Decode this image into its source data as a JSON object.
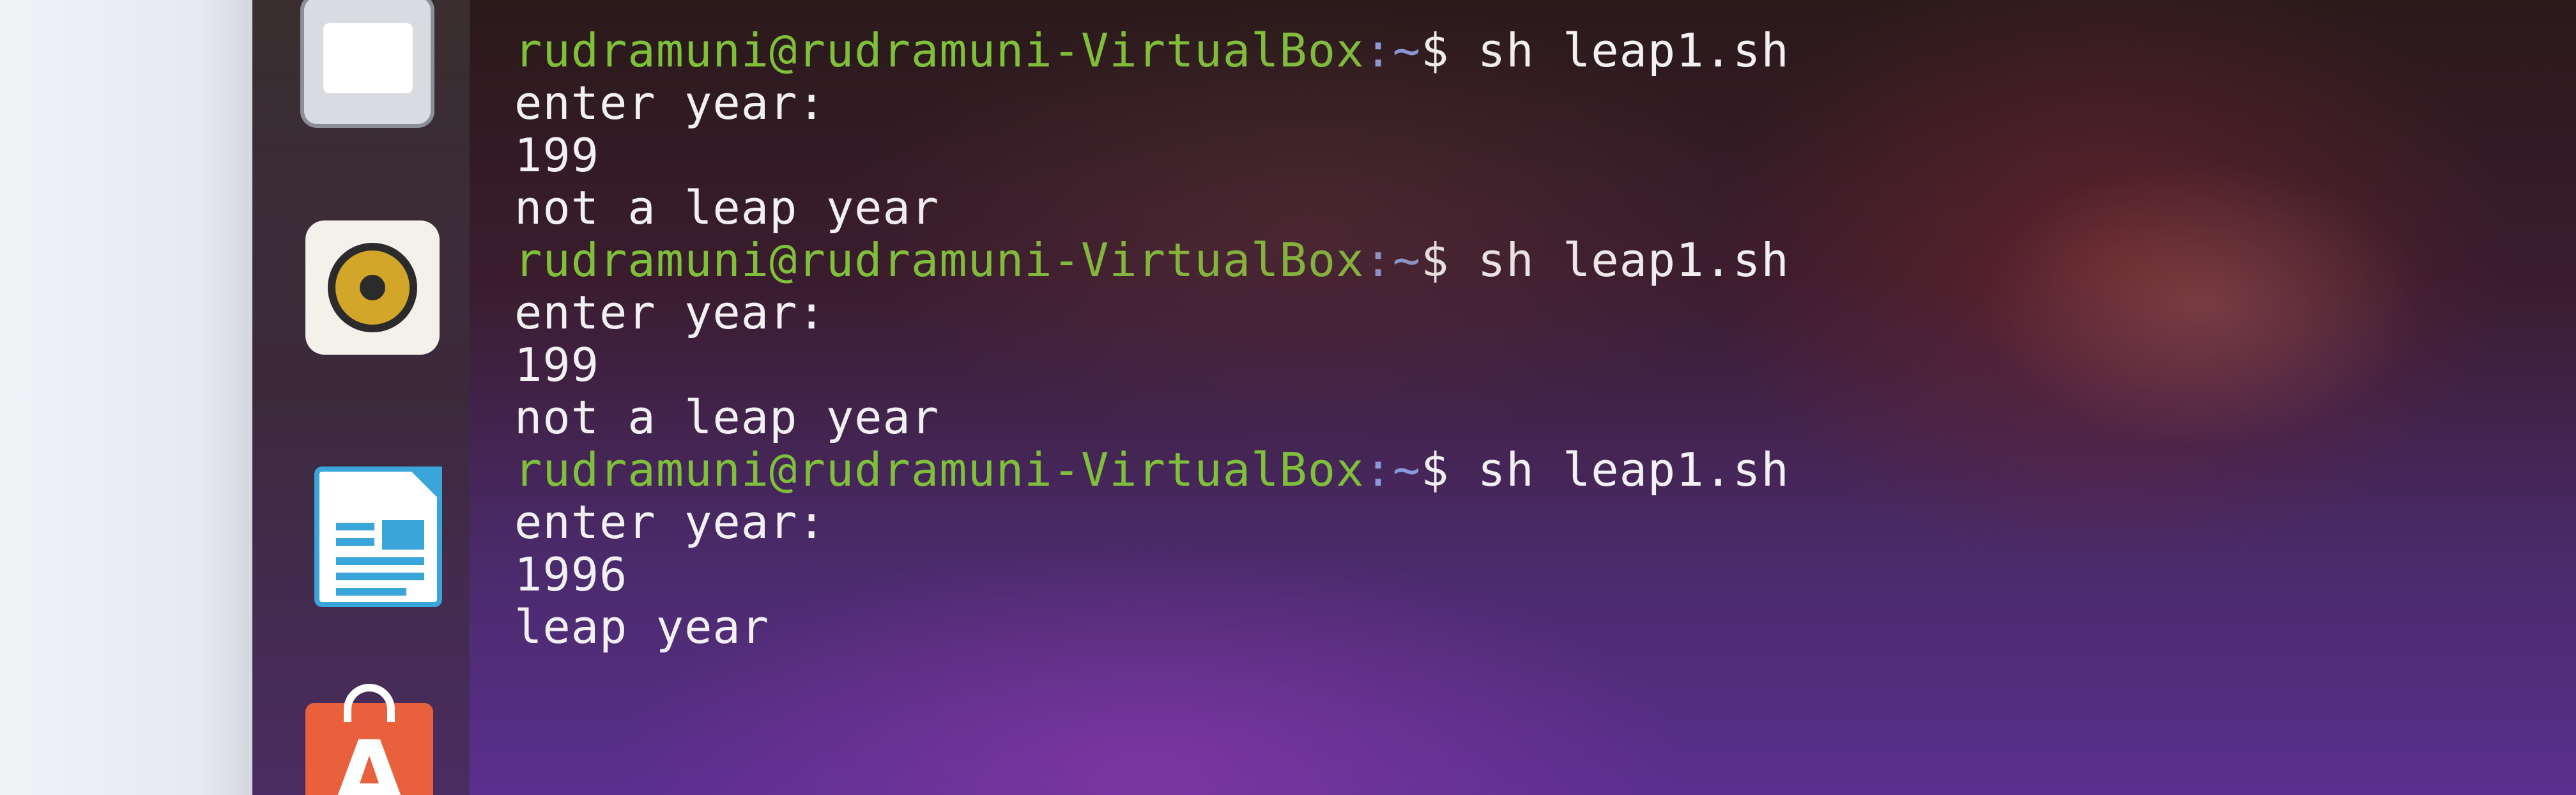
{
  "dock": {
    "items": [
      {
        "name": "files",
        "icon": "folder-icon"
      },
      {
        "name": "rhythmbox",
        "icon": "speaker-icon"
      },
      {
        "name": "libreoffice-impress",
        "icon": "document-icon"
      },
      {
        "name": "software-center",
        "icon": "shopping-bag-icon",
        "letter": "A"
      }
    ]
  },
  "terminal": {
    "colors": {
      "user": "#7fc03a",
      "path": "#8a9ad8",
      "text": "#f2f0f2"
    },
    "cut_top_text": "",
    "lines": [
      {
        "type": "prompt",
        "user": "rudramuni@rudramuni-VirtualBox",
        "path": ":~",
        "sym": "$ ",
        "cmd": "sh leap1.sh"
      },
      {
        "type": "output",
        "text": "enter year:"
      },
      {
        "type": "output",
        "text": "199"
      },
      {
        "type": "output",
        "text": "not a leap year"
      },
      {
        "type": "prompt",
        "user": "rudramuni@rudramuni-VirtualBox",
        "path": ":~",
        "sym": "$ ",
        "cmd": "sh leap1.sh"
      },
      {
        "type": "output",
        "text": "enter year:"
      },
      {
        "type": "output",
        "text": "199"
      },
      {
        "type": "output",
        "text": "not a leap year"
      },
      {
        "type": "prompt",
        "user": "rudramuni@rudramuni-VirtualBox",
        "path": ":~",
        "sym": "$ ",
        "cmd": "sh leap1.sh"
      },
      {
        "type": "output",
        "text": "enter year:"
      },
      {
        "type": "output",
        "text": "1996"
      },
      {
        "type": "output",
        "text": "leap year"
      }
    ]
  }
}
